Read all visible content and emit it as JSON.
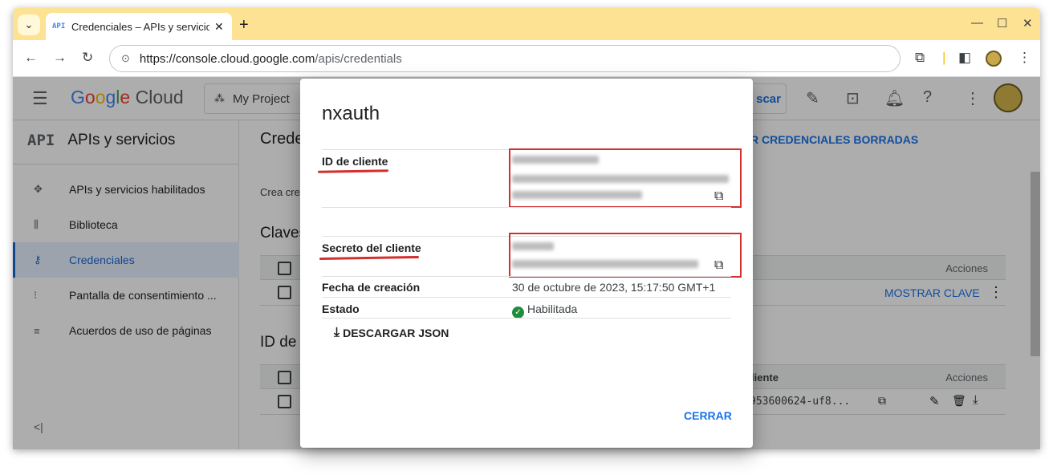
{
  "browser": {
    "tab_favicon": "API",
    "tab_title": "Credenciales – APIs y servicios",
    "new_tab": "+",
    "close": "✕",
    "url_host": "https://console.cloud.google.com",
    "url_path": "/apis/credentials"
  },
  "header": {
    "logo_google": [
      "G",
      "o",
      "o",
      "g",
      "l",
      "e"
    ],
    "logo_cloud": "Cloud",
    "project": "My Project",
    "search_label": "scar"
  },
  "sidebar": {
    "api_mark": "API",
    "title": "APIs y servicios",
    "items": [
      {
        "label": "APIs y servicios habilitados",
        "icon": "apis-icon"
      },
      {
        "label": "Biblioteca",
        "icon": "library-icon"
      },
      {
        "label": "Credenciales",
        "icon": "key-icon"
      },
      {
        "label": "Pantalla de consentimiento ...",
        "icon": "consent-icon"
      },
      {
        "label": "Acuerdos de uso de páginas",
        "icon": "settings-list-icon"
      }
    ],
    "collapse": "<|"
  },
  "main": {
    "title": "Crede",
    "restore": "R CREDENCIALES BORRADAS",
    "crea": "Crea cre",
    "section_keys": "Claves",
    "section_ids": "ID de",
    "acciones": "Acciones",
    "show_key": "MOSTRAR CLAVE",
    "id_col": "liente",
    "client_id_short": "953600624-uf8..."
  },
  "dialog": {
    "title": "nxauth",
    "client_id_label": "ID de cliente",
    "client_secret_label": "Secreto del cliente",
    "created_label": "Fecha de creación",
    "created_value": "30 de octubre de 2023, 15:17:50 GMT+1",
    "status_label": "Estado",
    "status_value": "Habilitada",
    "download": "DESCARGAR JSON",
    "close": "CERRAR"
  }
}
